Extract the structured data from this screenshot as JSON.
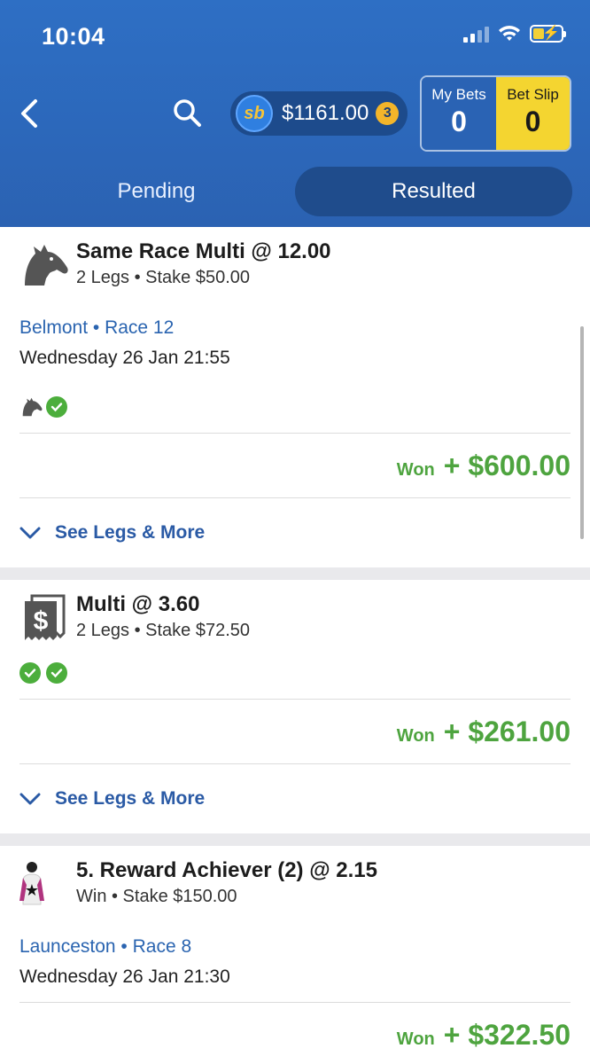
{
  "status_bar": {
    "time": "10:04"
  },
  "header": {
    "balance": "$1161.00",
    "balance_badge": "3",
    "sb_logo": "sb",
    "my_bets_label": "My Bets",
    "my_bets_count": "0",
    "bet_slip_label": "Bet Slip",
    "bet_slip_count": "0"
  },
  "tabs": [
    {
      "label": "Pending",
      "active": false
    },
    {
      "label": "Resulted",
      "active": true
    }
  ],
  "bets": [
    {
      "icon": "horse-icon",
      "title": "Same Race Multi @ 12.00",
      "subtitle": "2 Legs • Stake $50.00",
      "venue": "Belmont",
      "race": "Race 12",
      "date": "Wednesday 26 Jan 21:55",
      "result_label": "Won",
      "result_amount": "+ $600.00",
      "see_legs": "See Legs & More"
    },
    {
      "icon": "multi-ticket-icon",
      "title": "Multi @ 3.60",
      "subtitle": "2 Legs • Stake $72.50",
      "result_label": "Won",
      "result_amount": "+ $261.00",
      "see_legs": "See Legs & More"
    },
    {
      "icon": "jockey-silks-icon",
      "title": "5. Reward Achiever (2) @ 2.15",
      "subtitle": "Win • Stake $150.00",
      "venue": "Launceston",
      "race": "Race 8",
      "date": "Wednesday 26 Jan 21:30",
      "result_label": "Won",
      "result_amount": "+ $322.50"
    }
  ],
  "colors": {
    "header_blue": "#2c68bb",
    "win_green": "#4ea43f",
    "link_blue": "#2a64b0",
    "bet_slip_yellow": "#f4d530"
  }
}
